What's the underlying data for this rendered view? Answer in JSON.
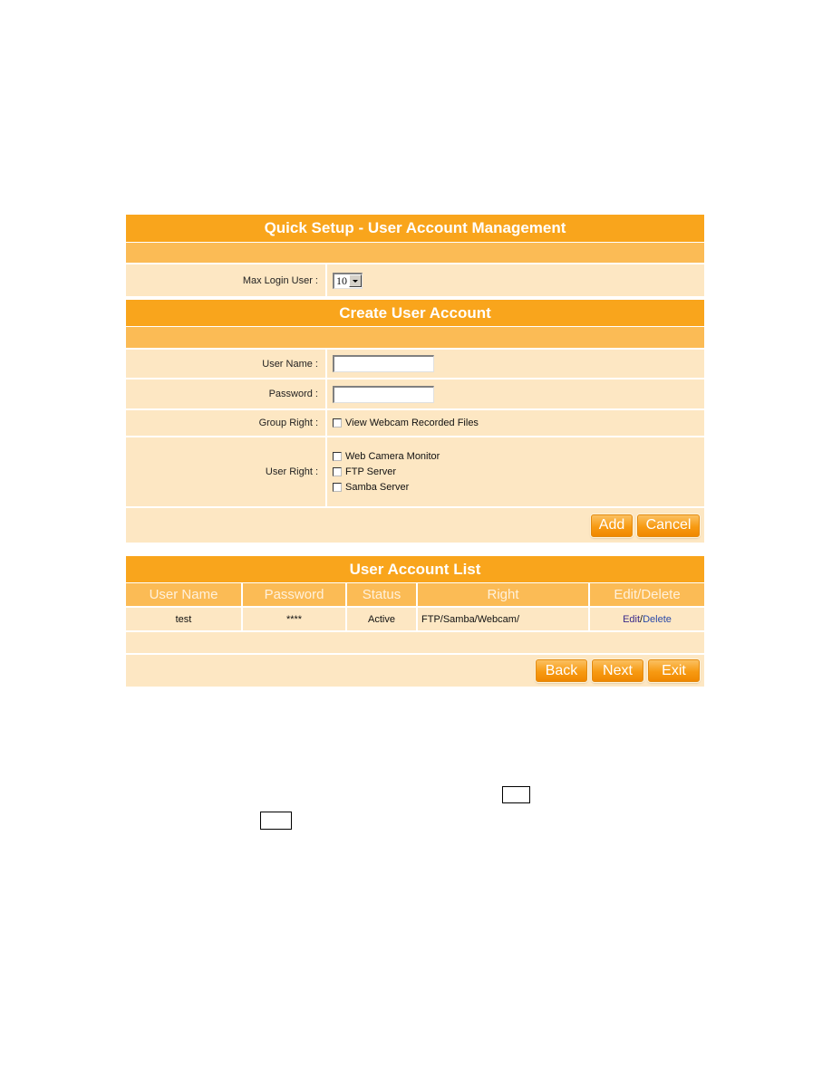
{
  "quick_setup": {
    "title": "Quick Setup - User Account Management",
    "max_login_label": "Max Login User :",
    "max_login_value": "10"
  },
  "create_account": {
    "title": "Create User Account",
    "username_label": "User Name :",
    "username_value": "",
    "password_label": "Password :",
    "password_value": "",
    "group_right_label": "Group Right :",
    "group_rights": [
      {
        "label": "View Webcam Recorded Files",
        "checked": false
      }
    ],
    "user_right_label": "User Right :",
    "user_rights": [
      {
        "label": "Web Camera Monitor",
        "checked": false
      },
      {
        "label": "FTP Server",
        "checked": false
      },
      {
        "label": "Samba Server",
        "checked": false
      }
    ],
    "add_label": "Add",
    "cancel_label": "Cancel"
  },
  "account_list": {
    "title": "User Account List",
    "columns": [
      "User Name",
      "Password",
      "Status",
      "Right",
      "Edit/Delete"
    ],
    "rows": [
      {
        "user_name": "test",
        "password": "****",
        "status": "Active",
        "right": "FTP/Samba/Webcam/",
        "edit": "Edit",
        "sep": "/",
        "delete": "Delete"
      }
    ],
    "back_label": "Back",
    "next_label": "Next",
    "exit_label": "Exit"
  },
  "colors": {
    "header_orange": "#f9a51c",
    "subbar_orange": "#fbbb55",
    "row_cream": "#fde7c3",
    "link": "#3a2a8a"
  }
}
